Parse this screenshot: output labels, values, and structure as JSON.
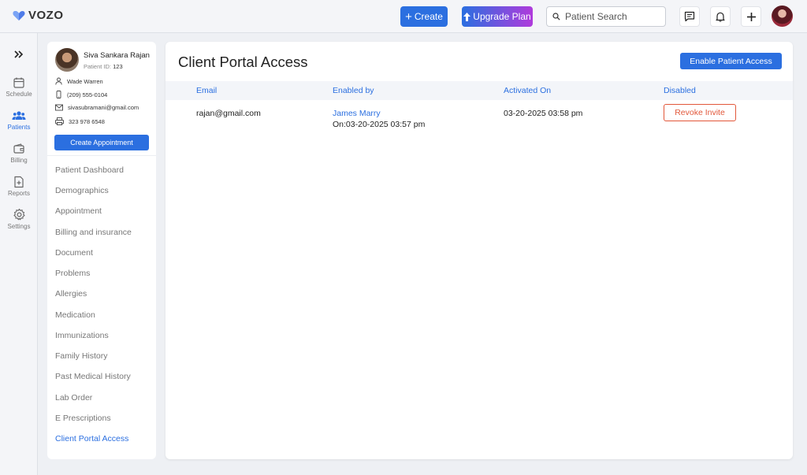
{
  "app": {
    "logo_text": "VOZO"
  },
  "topbar": {
    "create_label": "Create",
    "upgrade_label": "Upgrade Plan",
    "search_placeholder": "Patient Search"
  },
  "rail": {
    "items": [
      {
        "label": "Schedule",
        "icon": "calendar-icon"
      },
      {
        "label": "Patients",
        "icon": "users-icon",
        "active": true
      },
      {
        "label": "Billing",
        "icon": "wallet-icon"
      },
      {
        "label": "Reports",
        "icon": "report-icon"
      },
      {
        "label": "Settings",
        "icon": "gear-icon"
      }
    ]
  },
  "patient": {
    "name": "Siva Sankara Rajan",
    "id_label": "Patient ID:",
    "id_value": "123",
    "contact_name": "Wade Warren",
    "phone": "(209) 555-0104",
    "email": "sivasubramani@gmail.com",
    "fax": "323 978 6548",
    "create_appointment_label": "Create Appointment"
  },
  "patient_menu": [
    "Patient Dashboard",
    "Demographics",
    "Appointment",
    "Billing and insurance",
    "Document",
    "Problems",
    "Allergies",
    "Medication",
    "Immunizations",
    "Family History",
    "Past Medical History",
    "Lab Order",
    "E Prescriptions",
    "Client Portal Access"
  ],
  "active_menu": "Client Portal Access",
  "main": {
    "title": "Client Portal Access",
    "enable_button": "Enable Patient Access",
    "columns": [
      "Email",
      "Enabled by",
      "Activated On",
      "Disabled"
    ],
    "rows": [
      {
        "email": "rajan@gmail.com",
        "enabled_by": "James Marry",
        "enabled_on": "On:03-20-2025 03:57 pm",
        "activated_on": "03-20-2025 03:58 pm",
        "action": "Revoke Invite"
      }
    ]
  },
  "colors": {
    "primary": "#2b6fe0",
    "danger": "#e2573a",
    "gradient_end": "#b03bdc"
  }
}
